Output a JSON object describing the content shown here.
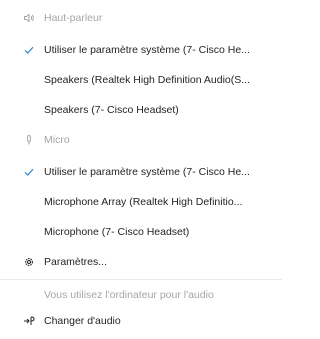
{
  "speakers_section": {
    "label": "Haut-parleur",
    "icon": "speaker-icon",
    "items": [
      {
        "label": "Utiliser le paramètre système (7- Cisco He...",
        "selected": true
      },
      {
        "label": "Speakers (Realtek High Definition Audio(S...",
        "selected": false
      },
      {
        "label": "Speakers (7- Cisco Headset)",
        "selected": false
      }
    ]
  },
  "micro_section": {
    "label": "Micro",
    "icon": "microphone-icon",
    "items": [
      {
        "label": "Utiliser le paramètre système (7- Cisco He...",
        "selected": true
      },
      {
        "label": "Microphone Array (Realtek High Definitio...",
        "selected": false
      },
      {
        "label": "Microphone (7- Cisco Headset)",
        "selected": false
      }
    ]
  },
  "settings": {
    "label": "Paramètres...",
    "icon": "gear-icon"
  },
  "audio_notice": {
    "label": "Vous utilisez l'ordinateur pour l'audio"
  },
  "change_audio": {
    "label": "Changer d'audio",
    "icon": "switch-audio-icon"
  },
  "colors": {
    "accent": "#2b88d8",
    "muted": "#a6a6a6",
    "text": "#242424"
  }
}
